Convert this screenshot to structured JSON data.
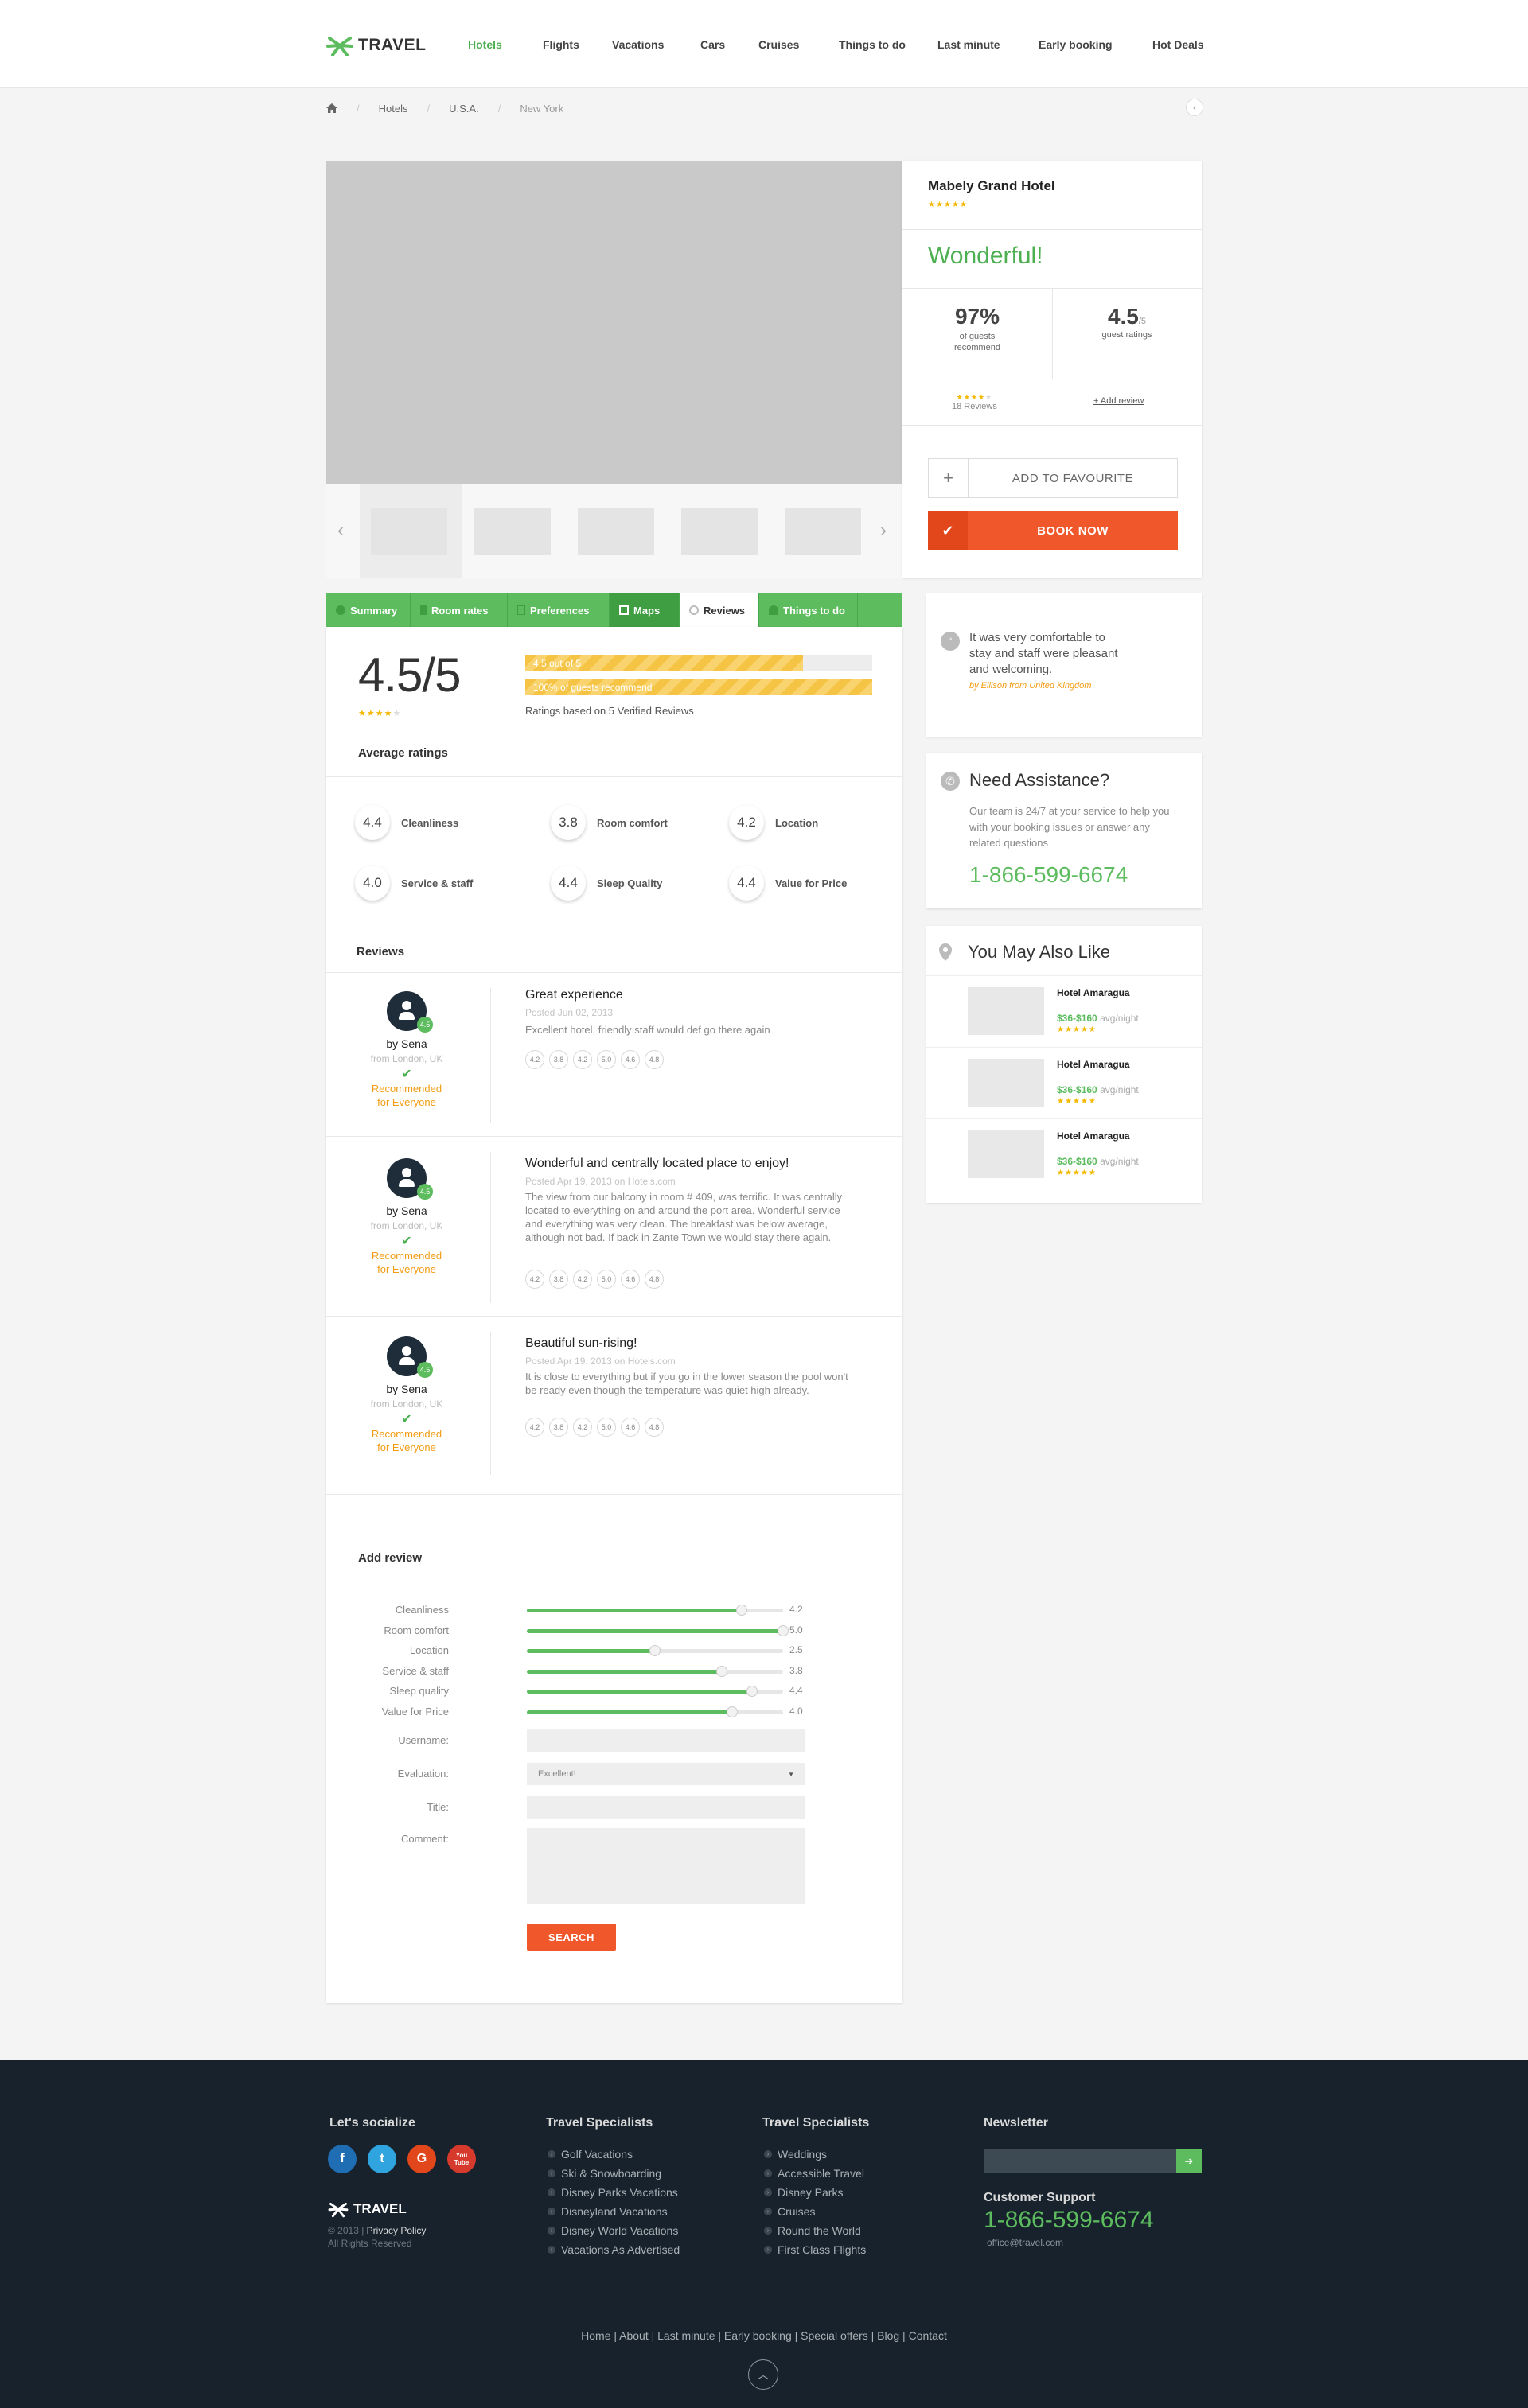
{
  "header": {
    "logo_text": "TRAVEL",
    "nav": [
      "Hotels",
      "Flights",
      "Vacations",
      "Cars",
      "Cruises",
      "Things to do",
      "Last minute",
      "Early booking",
      "Hot Deals"
    ],
    "active_nav": "Hotels"
  },
  "breadcrumb": [
    "Hotels",
    "U.S.A.",
    "New York"
  ],
  "hotel": {
    "name": "Mabely Grand Hotel",
    "stars": "★★★★★",
    "verdict": "Wonderful!",
    "recommend_value": "97%",
    "recommend_label": "of guests recommend",
    "rating_value": "4.5",
    "rating_of": "/5",
    "rating_label": "guest ratings",
    "review_count": "18 Reviews",
    "add_review": "+ Add review",
    "favourite_label": "ADD TO FAVOURITE",
    "book_label": "BOOK NOW"
  },
  "tabs": [
    "Summary",
    "Room rates",
    "Preferences",
    "Maps",
    "Reviews",
    "Things to do"
  ],
  "summary": {
    "score": "4.5/5",
    "bar1_label": "4.5 out of 5",
    "bar1_fraction": 0.8,
    "bar2_label": "100% of guests recommend",
    "bar2_fraction": 1.0,
    "based_on": "Ratings based on 5 Verified Reviews"
  },
  "average_title": "Average ratings",
  "averages": [
    {
      "score": "4.4",
      "label": "Cleanliness"
    },
    {
      "score": "3.8",
      "label": "Room comfort"
    },
    {
      "score": "4.2",
      "label": "Location"
    },
    {
      "score": "4.0",
      "label": "Service & staff"
    },
    {
      "score": "4.4",
      "label": "Sleep Quality"
    },
    {
      "score": "4.4",
      "label": "Value for Price"
    }
  ],
  "reviews_title": "Reviews",
  "reviews": [
    {
      "badge": "4.5",
      "by": "by Sena",
      "from": "from London, UK",
      "rec1": "Recommended",
      "rec2": "for Everyone",
      "title": "Great experience",
      "date": "Posted Jun 02, 2013",
      "text": "Excellent hotel, friendly staff would def go there again",
      "scores": [
        "4.2",
        "3.8",
        "4.2",
        "5.0",
        "4.6",
        "4.8"
      ]
    },
    {
      "badge": "4.5",
      "by": "by Sena",
      "from": "from London, UK",
      "rec1": "Recommended",
      "rec2": "for Everyone",
      "title": "Wonderful and centrally located place to enjoy!",
      "date": "Posted Apr 19, 2013 on Hotels.com",
      "text": "The view from our balcony in room # 409, was terrific. It was centrally located to everything on and around the port area. Wonderful service and everything was very clean. The breakfast was below average, although not bad. If back in Zante Town we would stay there again.",
      "scores": [
        "4.2",
        "3.8",
        "4.2",
        "5.0",
        "4.6",
        "4.8"
      ]
    },
    {
      "badge": "4.5",
      "by": "by Sena",
      "from": "from London, UK",
      "rec1": "Recommended",
      "rec2": "for Everyone",
      "title": "Beautiful sun-rising!",
      "date": "Posted Apr 19, 2013 on Hotels.com",
      "text": "It is close to everything but if you go in the lower season the pool won't be ready even though the temperature was quiet high already.",
      "scores": [
        "4.2",
        "3.8",
        "4.2",
        "5.0",
        "4.6",
        "4.8"
      ]
    }
  ],
  "add_review": {
    "title": "Add review",
    "sliders": [
      {
        "label": "Cleanliness",
        "value": "4.2",
        "level": 0.84
      },
      {
        "label": "Room comfort",
        "value": "5.0",
        "level": 1.0
      },
      {
        "label": "Location",
        "value": "2.5",
        "level": 0.5
      },
      {
        "label": "Service & staff",
        "value": "3.8",
        "level": 0.76
      },
      {
        "label": "Sleep quality",
        "value": "4.4",
        "level": 0.88
      },
      {
        "label": "Value for Price",
        "value": "4.0",
        "level": 0.8
      }
    ],
    "username_label": "Username:",
    "evaluation_label": "Evaluation:",
    "evaluation_value": "Excellent!",
    "title_label": "Title:",
    "comment_label": "Comment:",
    "submit_label": "SEARCH"
  },
  "testimonial": {
    "text": "It was very comfortable to stay and staff were pleasant and welcoming.",
    "author": "by Ellison from United Kingdom"
  },
  "assistance": {
    "title": "Need Assistance?",
    "text": "Our team is 24/7 at your service to help you with your booking issues or answer any related questions",
    "phone": "1-866-599-6674"
  },
  "also_like": {
    "title": "You May Also Like",
    "items": [
      {
        "name": "Hotel Amaragua",
        "price": "$36-$160",
        "unit": "avg/night",
        "stars": "★★★★★"
      },
      {
        "name": "Hotel Amaragua",
        "price": "$36-$160",
        "unit": "avg/night",
        "stars": "★★★★★"
      },
      {
        "name": "Hotel Amaragua",
        "price": "$36-$160",
        "unit": "avg/night",
        "stars": "★★★★★"
      }
    ]
  },
  "footer": {
    "social_title": "Let's socialize",
    "social": [
      "f",
      "t",
      "G",
      "You Tube"
    ],
    "logo_text": "TRAVEL",
    "copyright": "© 2013",
    "privacy": "Privacy Policy",
    "rights": "All Rights Reserved",
    "col1_title": "Travel Specialists",
    "col1": [
      "Golf Vacations",
      "Ski & Snowboarding",
      "Disney Parks Vacations",
      "Disneyland Vacations",
      "Disney World Vacations",
      "Vacations As Advertised"
    ],
    "col2_title": "Travel Specialists",
    "col2": [
      "Weddings",
      "Accessible Travel",
      "Disney Parks",
      "Cruises",
      "Round the World",
      "First Class Flights"
    ],
    "newsletter_title": "Newsletter",
    "support_title": "Customer Support",
    "support_phone": "1-866-599-6674",
    "support_mail": "office@travel.com",
    "links": "Home | About | Last minute | Early booking | Special offers | Blog | Contact"
  }
}
